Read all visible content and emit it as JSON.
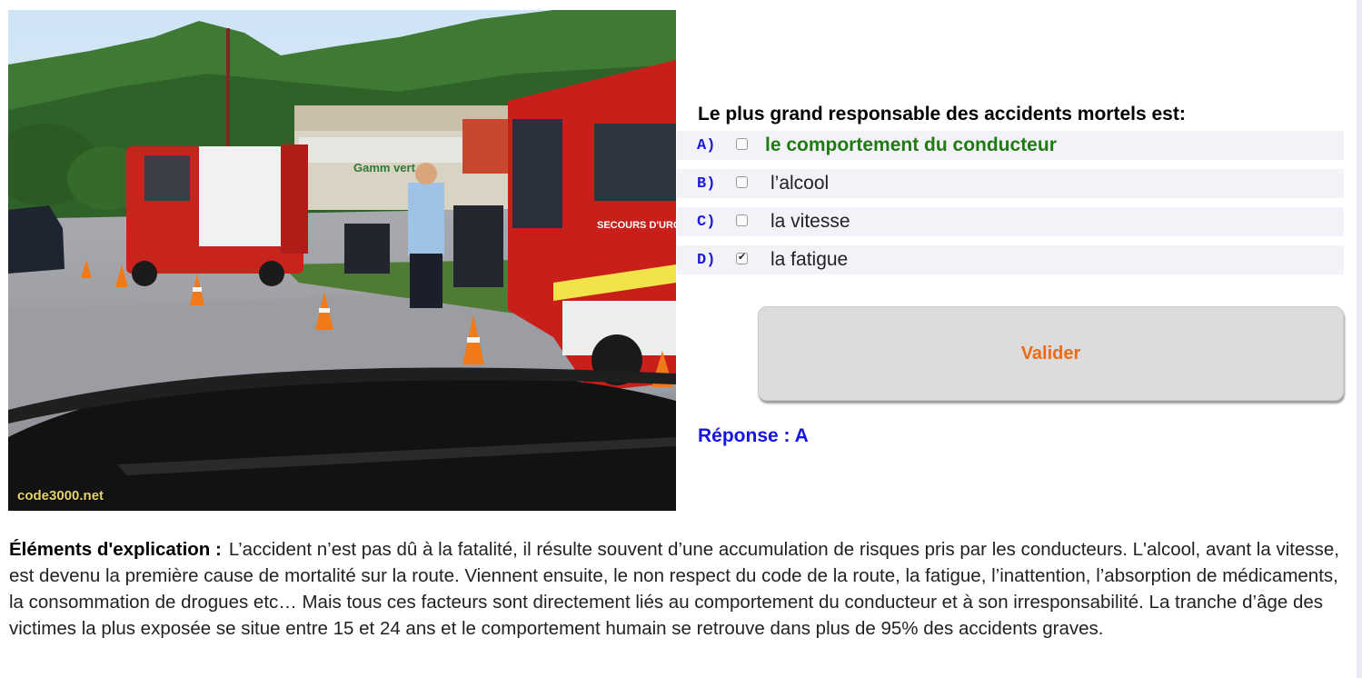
{
  "photo": {
    "watermark": "code3000.net",
    "sign_text": "Gamm vert",
    "truck_text": "SECOURS D'URGENCE"
  },
  "question": {
    "text": "Le plus grand responsable des accidents mortels est:"
  },
  "options": [
    {
      "letter": "A)",
      "text": "le comportement du conducteur",
      "checked": false,
      "correct": true
    },
    {
      "letter": "B)",
      "text": "l’alcool",
      "checked": false,
      "correct": false
    },
    {
      "letter": "C)",
      "text": "la vitesse",
      "checked": false,
      "correct": false
    },
    {
      "letter": "D)",
      "text": "la fatigue",
      "checked": true,
      "correct": false
    }
  ],
  "validate_label": "Valider",
  "answer_text": "Réponse : A",
  "explanation": {
    "title": "Éléments d'explication :",
    "body": "L’accident n’est pas dû à la fatalité, il résulte souvent d’une accumulation de risques pris par les conducteurs. L'alcool, avant la vitesse, est devenu la première cause de mortalité sur la route. Viennent ensuite, le non respect du code de la route, la fatigue, l’inattention, l’absorption de médicaments, la consommation de drogues etc… Mais tous ces facteurs sont directement liés au comportement du conducteur et à son irresponsabilité. La tranche d’âge des victimes la plus exposée se situe entre 15 et 24 ans et le comportement humain se retrouve dans plus de 95% des accidents graves."
  },
  "colors": {
    "question_accent": "#1b1bd6",
    "correct_option": "#1f7a12",
    "validate_text": "#ee6a16",
    "answer_text": "#1515e0",
    "option_bg": "#f3f2f9"
  }
}
